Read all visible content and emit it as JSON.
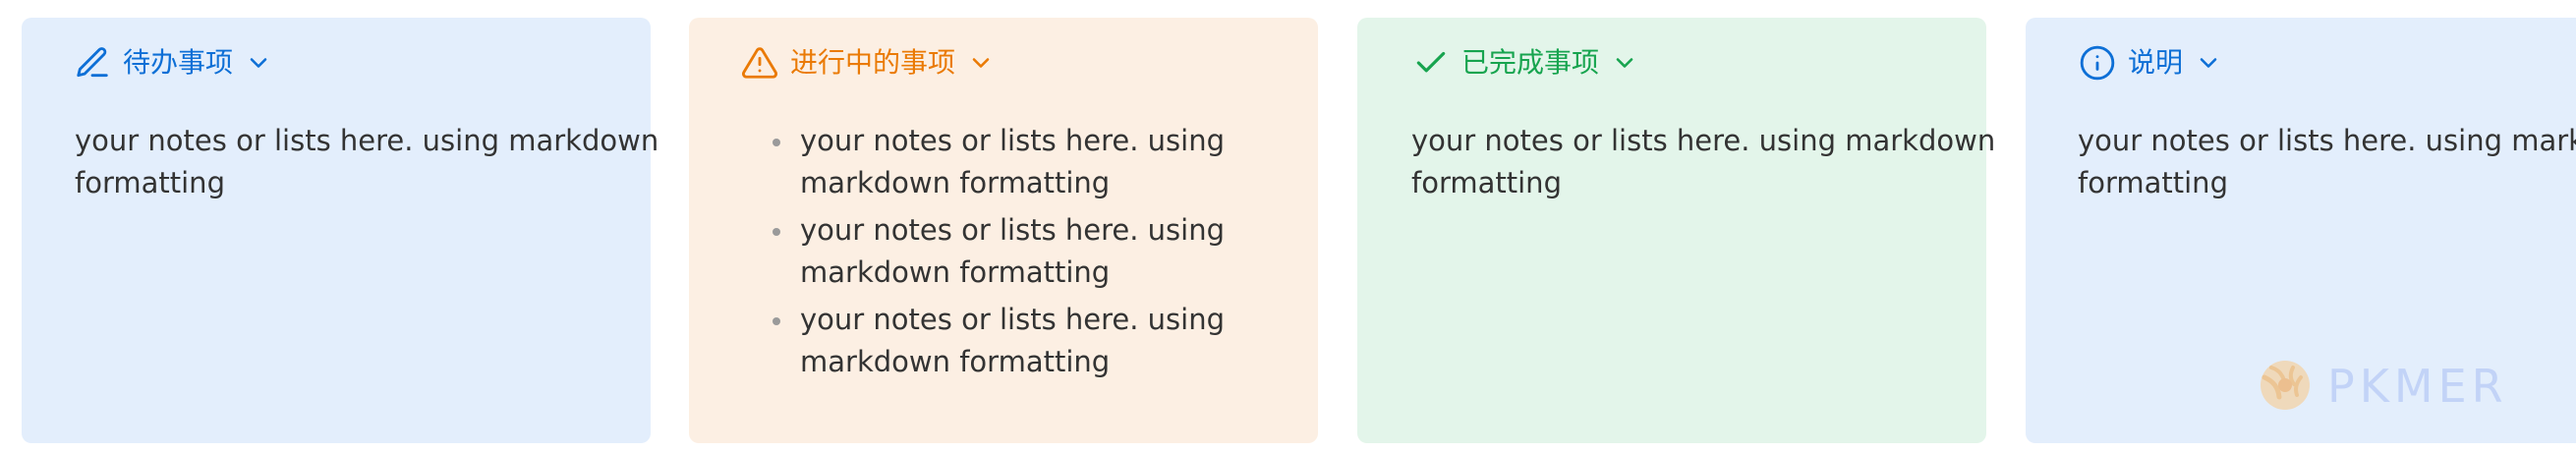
{
  "callouts": [
    {
      "type": "todo",
      "title": "待办事项",
      "icon": "pencil-icon",
      "accent": "#0d6fd6",
      "background": "#e3eefc",
      "body": {
        "lines": [
          "your notes or lists here. using markdown",
          "formatting"
        ]
      }
    },
    {
      "type": "in-progress",
      "title": "进行中的事项",
      "icon": "warning-triangle-icon",
      "accent": "#ea7a05",
      "background": "#fcefe3",
      "body": {
        "items": [
          {
            "lines": [
              "your notes or lists here. using",
              "markdown formatting"
            ]
          },
          {
            "lines": [
              "your notes or lists here. using",
              "markdown formatting"
            ]
          },
          {
            "lines": [
              "your notes or lists here. using",
              "markdown formatting"
            ]
          }
        ]
      }
    },
    {
      "type": "done",
      "title": "已完成事项",
      "icon": "checkmark-icon",
      "accent": "#17a44f",
      "background": "#e3f5ea",
      "body": {
        "lines": [
          "your notes or lists here. using markdown",
          "formatting"
        ]
      }
    },
    {
      "type": "info",
      "title": "说明",
      "icon": "info-circle-icon",
      "accent": "#0d6fd6",
      "background": "#e3eefc",
      "body": {
        "lines": [
          "your notes or lists here. using markdov",
          "formatting"
        ]
      }
    }
  ],
  "watermark": {
    "text": "PKMER",
    "logo": "pkmer-logo",
    "color": "#b8caf6"
  }
}
